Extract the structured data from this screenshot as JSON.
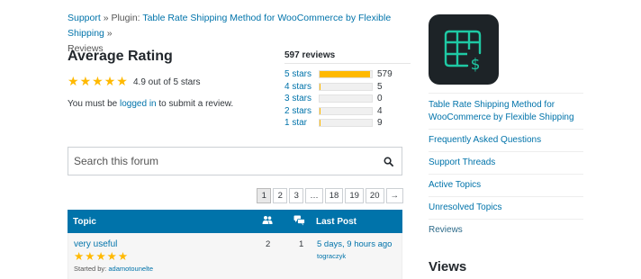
{
  "breadcrumb": {
    "support": "Support",
    "sep1": "»",
    "plugin_prefix": "Plugin:",
    "plugin_name": "Table Rate Shipping Method for WooCommerce by Flexible Shipping",
    "sep2": "»",
    "current": "Reviews"
  },
  "rating": {
    "title": "Average Rating",
    "stars": 5,
    "summary": "4.9 out of 5 stars",
    "submit_prefix": "You must be ",
    "submit_link": "logged in",
    "submit_suffix": " to submit a review."
  },
  "reviews": {
    "total": "597 reviews",
    "rows": [
      {
        "label": "5 stars",
        "count": "579",
        "fraction": 0.97
      },
      {
        "label": "4 stars",
        "count": "5",
        "fraction": 0.01
      },
      {
        "label": "3 stars",
        "count": "0",
        "fraction": 0
      },
      {
        "label": "2 stars",
        "count": "4",
        "fraction": 0.01
      },
      {
        "label": "1 star",
        "count": "9",
        "fraction": 0.02
      }
    ]
  },
  "search": {
    "placeholder": "Search this forum",
    "icon": "search-icon"
  },
  "pagination": [
    "1",
    "2",
    "3",
    "…",
    "18",
    "19",
    "20",
    "→"
  ],
  "topics": {
    "header": {
      "topic": "Topic",
      "voices_icon": "users-icon",
      "posts_icon": "comments-icon",
      "last_post": "Last Post"
    },
    "rows": [
      {
        "title": "very useful",
        "stars": 5,
        "started_by_label": "Started by:",
        "started_by": "adamotounelte",
        "voices": "2",
        "posts": "1",
        "freshness": "5 days, 9 hours ago",
        "last_user": "tograczyk"
      }
    ]
  },
  "sidebar": {
    "plugin_name": "Table Rate Shipping Method for WooCommerce by Flexible Shipping",
    "links": [
      "Frequently Asked Questions",
      "Support Threads",
      "Active Topics",
      "Unresolved Topics",
      "Reviews"
    ],
    "views_title": "Views"
  },
  "colors": {
    "link": "#0073aa",
    "star": "#ffb900",
    "header_bg": "#0073aa",
    "icon_bg": "#1d2327",
    "icon_line": "#1fc9a4"
  }
}
